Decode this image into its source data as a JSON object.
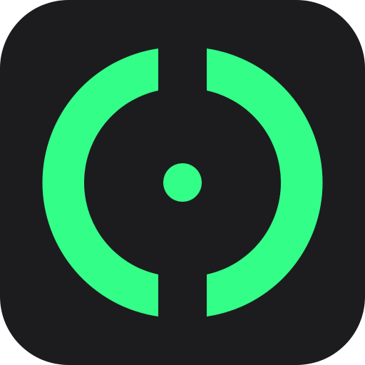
{
  "icon": {
    "name": "app-icon",
    "symbol": "split-ring-with-center-dot-icon",
    "colors": {
      "page_background": "#ffffff",
      "tile_background": "#1c1c1f",
      "accent": "#33ff88"
    }
  }
}
